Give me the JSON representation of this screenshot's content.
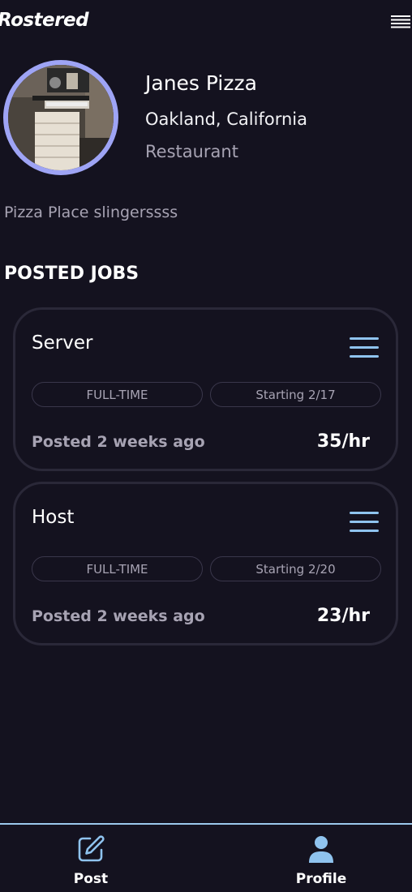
{
  "header": {
    "logo_text": "Rostered",
    "menu_icon": "hamburger-menu-icon"
  },
  "profile": {
    "name": "Janes Pizza",
    "location": "Oakland, California",
    "category": "Restaurant",
    "bio": "Pizza Place slingerssss",
    "avatar_border_color": "#9ea4f5"
  },
  "jobs_section": {
    "title": "POSTED JOBS",
    "jobs": [
      {
        "title": "Server",
        "type": "FULL-TIME",
        "start": "Starting 2/17",
        "posted": "Posted 2 weeks ago",
        "rate": "35/hr"
      },
      {
        "title": "Host",
        "type": "FULL-TIME",
        "start": "Starting 2/20",
        "posted": "Posted 2 weeks ago",
        "rate": "23/hr"
      }
    ]
  },
  "bottom_nav": {
    "items": [
      {
        "label": "Post",
        "icon": "edit-icon"
      },
      {
        "label": "Profile",
        "icon": "user-icon"
      }
    ]
  },
  "colors": {
    "background": "#14121f",
    "accent_blue": "#8fc3ee",
    "muted_text": "#a7a3b3",
    "card_border": "#2a2838"
  }
}
